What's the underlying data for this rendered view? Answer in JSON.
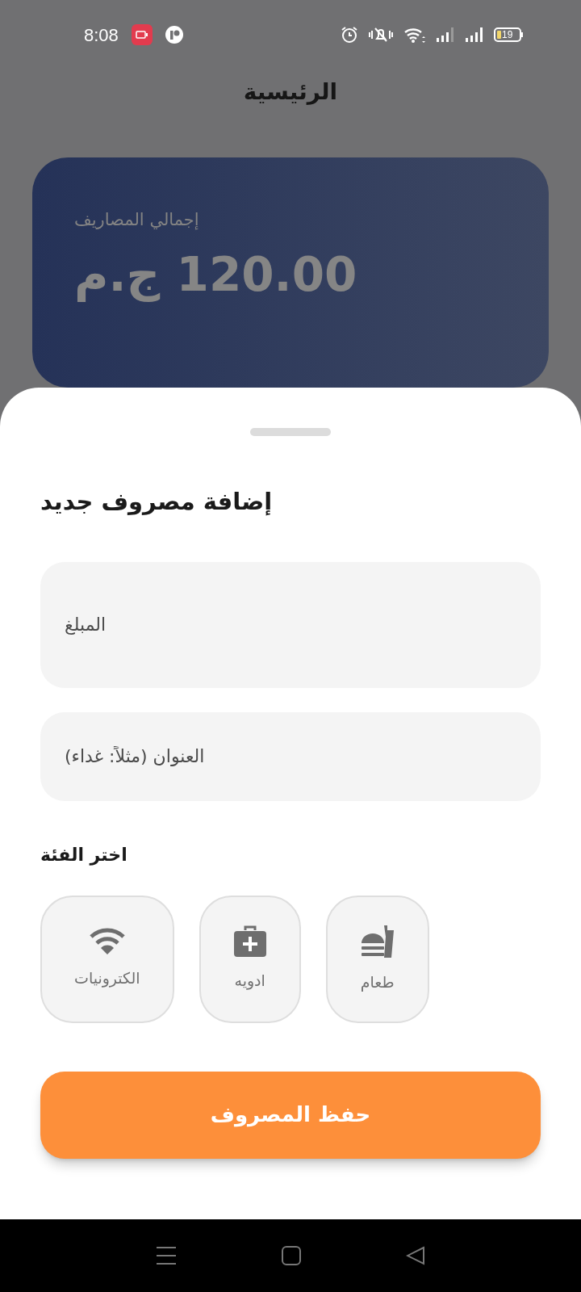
{
  "status_bar": {
    "time": "8:08",
    "battery": "19"
  },
  "header": {
    "title": "الرئيسية"
  },
  "summary_card": {
    "label": "إجمالي المصاريف",
    "amount": "120.00 ج.م"
  },
  "sheet": {
    "title": "إضافة مصروف جديد",
    "fields": [
      {
        "placeholder": "المبلغ",
        "kind": "tall"
      },
      {
        "placeholder": "العنوان (مثلاً: غداء)",
        "kind": "short"
      }
    ],
    "category_label": "اختر الفئة",
    "categories": [
      {
        "label": "طعام",
        "kind": "food",
        "selected": false
      },
      {
        "label": "ادويه",
        "kind": "medicine",
        "selected": false
      },
      {
        "label": "الكترونيات",
        "kind": "wifi",
        "selected": false
      }
    ],
    "save_button": "حفظ المصروف"
  }
}
